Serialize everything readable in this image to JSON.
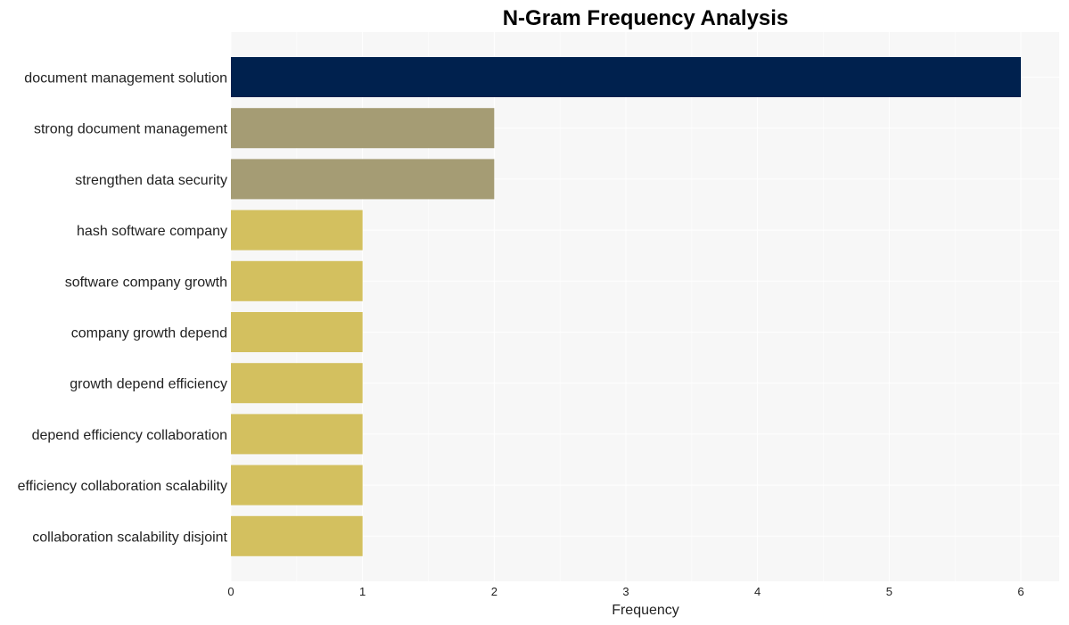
{
  "chart_data": {
    "type": "bar",
    "orientation": "horizontal",
    "title": "N-Gram Frequency Analysis",
    "xlabel": "Frequency",
    "ylabel": "",
    "xlim": [
      0,
      6.3
    ],
    "xticks": [
      0,
      1,
      2,
      3,
      4,
      5,
      6
    ],
    "grid": true,
    "categories": [
      "document management solution",
      "strong document management",
      "strengthen data security",
      "hash software company",
      "software company growth",
      "company growth depend",
      "growth depend efficiency",
      "depend efficiency collaboration",
      "efficiency collaboration scalability",
      "collaboration scalability disjoint"
    ],
    "values": [
      6,
      2,
      2,
      1,
      1,
      1,
      1,
      1,
      1,
      1
    ],
    "colors": [
      "#00214e",
      "#a59c74",
      "#a59c74",
      "#d3c05f",
      "#d3c05f",
      "#d3c05f",
      "#d3c05f",
      "#d3c05f",
      "#d3c05f",
      "#d3c05f"
    ],
    "background": "#f7f7f7"
  }
}
